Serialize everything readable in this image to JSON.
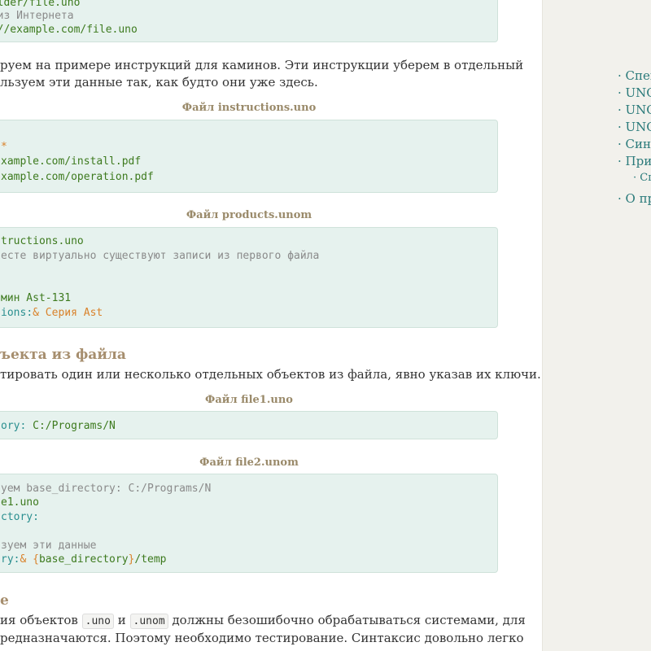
{
  "code_blocks": {
    "block1": {
      "lines": [
        [
          "folder/file.uno"
        ],
        [
          "ь из Интернета"
        ],
        [
          "p://example.com/file.uno"
        ]
      ]
    },
    "block2": {
      "lines": [
        [
          "*"
        ],
        [
          "xample.com/install.pdf"
        ],
        [
          "xample.com/operation.pdf"
        ]
      ]
    },
    "block3": {
      "line1": "tructions.uno",
      "line2": "есте виртуально существуют записи из первого файла",
      "line3": "мин Ast-131",
      "line4_key": "ions",
      "line4_sep": ":",
      "line4_val": "& Серия Ast"
    },
    "block4": {
      "key": "ory",
      "sep": ": ",
      "val": "C:/Programs/N"
    },
    "block5": {
      "line1": "уем base_directory: C:/Programs/N",
      "line2": "e1.uno",
      "line3_key": "ctory",
      "line3_sep": ":",
      "line4": "зуем эти данные",
      "line5_key": "ry",
      "line5_sep": ":",
      "line5_amp": "& ",
      "line5_open": "{",
      "line5_var": "base_directory",
      "line5_close": "}",
      "line5_tail": "/temp"
    }
  },
  "paragraphs": {
    "p1_line1": "руем на примере инструкций для каминов. Эти инструкции уберем в отдельный",
    "p1_line2": "льзуем эти данные так, как будто они уже здесь.",
    "p2": "тировать один или несколько отдельных объектов из файла, явно указав их ключи.",
    "p3_pre": "ия объектов",
    "p3_code1": ".uno",
    "p3_mid": "и",
    "p3_code2": ".unom",
    "p3_post": "должны безошибочно обрабатываться системами, для",
    "p3_line2": "редназначаются. Поэтому необходимо тестирование. Синтаксис довольно легко"
  },
  "file_names": {
    "f1": "Файл instructions.uno",
    "f2": "Файл products.unom",
    "f3": "Файл file1.uno",
    "f4": "Файл file2.unom"
  },
  "headings": {
    "h1": "ъекта из файла",
    "h2": "е"
  },
  "toc": {
    "items": [
      "· Спец",
      "· UNO",
      "· UNO",
      "· UNO",
      "· Синт",
      "· Прим",
      "· Сп",
      "· О пр"
    ]
  }
}
